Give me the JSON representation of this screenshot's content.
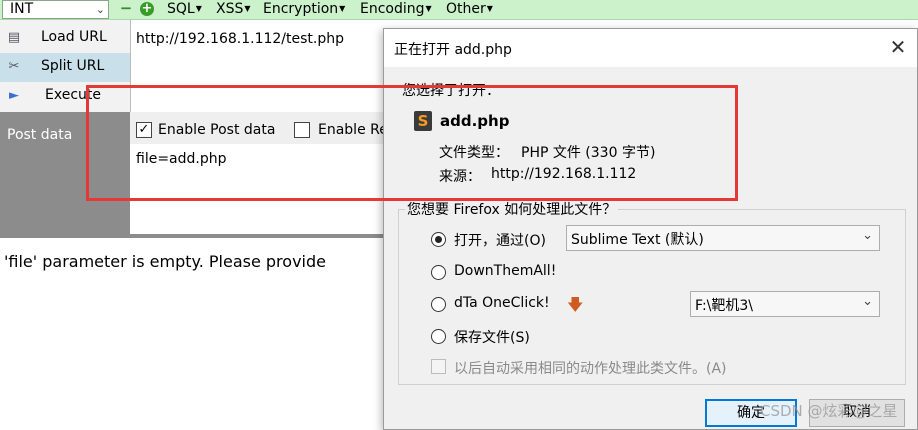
{
  "hackbar": {
    "mode_select": "INT",
    "menus": [
      "SQL",
      "XSS",
      "Encryption",
      "Encoding",
      "Other"
    ],
    "buttons": {
      "load_url": "Load URL",
      "split_url": "Split URL",
      "execute": "Execute"
    },
    "url_value": "http://192.168.1.112/test.php",
    "enable_post_label": "Enable Post data",
    "enable_referrer_label": "Enable Re",
    "enable_post_checked": true,
    "post_data_label": "Post data",
    "post_value": "file=add.php",
    "icons": [
      "minus-icon",
      "plus-icon",
      "load-url-icon",
      "split-url-icon",
      "execute-icon"
    ]
  },
  "response_text": "'file' parameter is empty. Please provide",
  "dialog": {
    "title": "正在打开 add.php",
    "chosen_label": "您选择了打开：",
    "file_name": "add.php",
    "type_label": "文件类型：",
    "type_value": "PHP 文件 (330 字节)",
    "source_label": "来源：",
    "source_value": "http://192.168.1.112",
    "question": "您想要 Firefox 如何处理此文件？",
    "options": {
      "open_with": "打开，通过(O)",
      "open_with_app": "Sublime Text (默认)",
      "downthemall": "DownThemAll!",
      "dta": "dTa OneClick!",
      "dta_path": "F:\\靶机3\\",
      "save_file": "保存文件(S)"
    },
    "selected_option": "open_with",
    "remember_label": "以后自动采用相同的动作处理此类文件。(A)",
    "ok_label": "确定",
    "cancel_label": "取消",
    "accent": "#0078d7"
  },
  "annotation_color": "#e53935",
  "watermark": "CSDN @炫彩@之星"
}
